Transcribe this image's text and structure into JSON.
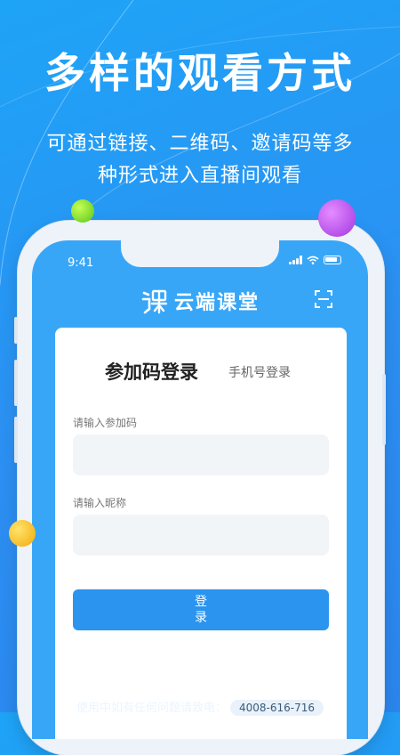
{
  "promo": {
    "headline": "多样的观看方式",
    "subline_1": "可通过链接、二维码、邀请码等多",
    "subline_2": "种形式进入直播间观看"
  },
  "status_bar": {
    "time": "9:41"
  },
  "app": {
    "name": "云端课堂"
  },
  "login": {
    "tab_active": "参加码登录",
    "tab_other": "手机号登录",
    "code_label": "请输入参加码",
    "code_value": "",
    "nickname_label": "请输入昵称",
    "nickname_value": "",
    "button_label": "登录"
  },
  "footer": {
    "text": "使用中如有任何问题请致电：",
    "phone": "4008-616-716"
  },
  "colors": {
    "background": "#2c8ff2",
    "screen": "#38a6f7",
    "button": "#2a94ef",
    "dot_green": "#58c41c",
    "dot_purple": "#a136e0",
    "dot_yellow": "#f3a90b"
  }
}
